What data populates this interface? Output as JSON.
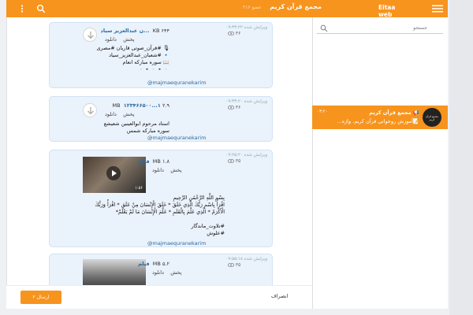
{
  "header": {
    "app_name": "Eitaa web",
    "channel_title": "مجمع قرآن کریم",
    "members": "عضو ۲۱۶"
  },
  "search": {
    "placeholder": "جستجو"
  },
  "chat_list": [
    {
      "title": "مجمع قرآن کریم",
      "preview": "📝آموزش روخوانی قرآن کریم. واژه...",
      "time": "۰۳:۲۰",
      "avatar_text": "مجمع قرآن کریم"
    }
  ],
  "messages": [
    {
      "meta": "ویرایش شده ۰۹:۳۳:۲۲",
      "views": "۳۶",
      "file_name": "...ن عبدالعزیز سیاد",
      "file_size": "۶۴۴ KB",
      "download": "دانلود",
      "play": "پخش",
      "lines": [
        "🎙 #قرآن_صوتی قاریان #مصری",
        "🔹 #شعبان_عبدالعزیز_سیاد",
        "📖 سوره مبارکه انعام",
        "▫️▪️▫️▪️▫️"
      ],
      "link": "@majmaequranekarim"
    },
    {
      "meta": "ویرایش شده ۰۹:۳۳:۲۰",
      "views": "۳۶",
      "file_name": "۱۲۳۴۶۶۵۰۰...۱",
      "file_size": "۲.۹ MB",
      "download": "دانلود",
      "play": "پخش",
      "lines": [
        "استاد مرحوم ابوالعینین شعیشع",
        "سوره مبارکه شمس"
      ],
      "link": "@majmaequranekarim"
    },
    {
      "meta": "ویرایش شده ۰۹:۲۵:۲۰",
      "views": "۳۵",
      "file_name": "فیلم",
      "file_size": "۱.۸ MB",
      "download": "دانلود",
      "play": "پخش",
      "duration": "۱:۵۶",
      "lines": [
        "بِسْمِ اللَّهِ الرَّحْمَٰنِ الرَّحِيمِ",
        "اقْرَأْ بِاسْمِ رَبِّكَ الَّذِي خَلَقَ * خَلَقَ الْإِنْسَانَ مِنْ عَلَقٍ * اقْرَأْ وَرَبُّكَ",
        "الْأَكْرَمُ * الَّذِي عَلَّمَ بِالْقَلَمِ * عَلَّمَ الْإِنْسَانَ مَا لَمْ يَعْلَمْ*",
        "",
        "#تلاوت_ماندگار",
        "#علوش"
      ],
      "link": "@majmaequranekarim"
    },
    {
      "meta": "ویرایش شده ۰۹:۵۵:۱۸",
      "views": "۳۵",
      "file_name": "فیلم",
      "file_size": "۵.۲ MB",
      "download": "دانلود",
      "play": "پخش"
    }
  ],
  "footer": {
    "confirm_label": "ارسال ۲",
    "cancel_label": "انصراف"
  },
  "colors": {
    "accent": "#f7941d",
    "bubble": "#eaf2fb",
    "link": "#2a6aa0"
  }
}
